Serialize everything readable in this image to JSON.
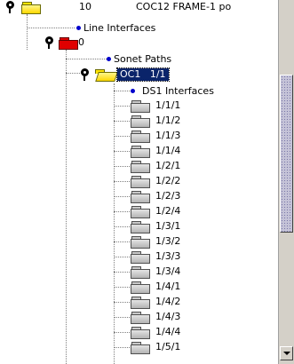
{
  "tree": {
    "root": {
      "label": "10",
      "description": "COC12 FRAME-1 po"
    },
    "line_interfaces": "Line Interfaces",
    "shelf": {
      "label": "0"
    },
    "sonet_paths": "Sonet Paths",
    "oc_node": {
      "label": "OC1   1/1"
    },
    "ds1_interfaces": "DS1 Interfaces",
    "ds1_items": [
      "1/1/1",
      "1/1/2",
      "1/1/3",
      "1/1/4",
      "1/2/1",
      "1/2/2",
      "1/2/3",
      "1/2/4",
      "1/3/1",
      "1/3/2",
      "1/3/3",
      "1/3/4",
      "1/4/1",
      "1/4/2",
      "1/4/3",
      "1/4/4",
      "1/5/1"
    ]
  },
  "colors": {
    "selection": "#0a246a",
    "bullet": "#0000cc",
    "root_folder": "#ffe400",
    "shelf_folder": "#e00000",
    "item_folder": "#c8c8c8"
  },
  "icons": {
    "expand_handle": "pin-icon",
    "root": "folder-yellow-icon",
    "shelf": "folder-red-icon",
    "oc_node": "folder-open-yellow-icon",
    "ds1_item": "folder-grey-icon",
    "leaf_bullet": "bullet-icon",
    "scroll_down": "arrow-down-icon"
  }
}
